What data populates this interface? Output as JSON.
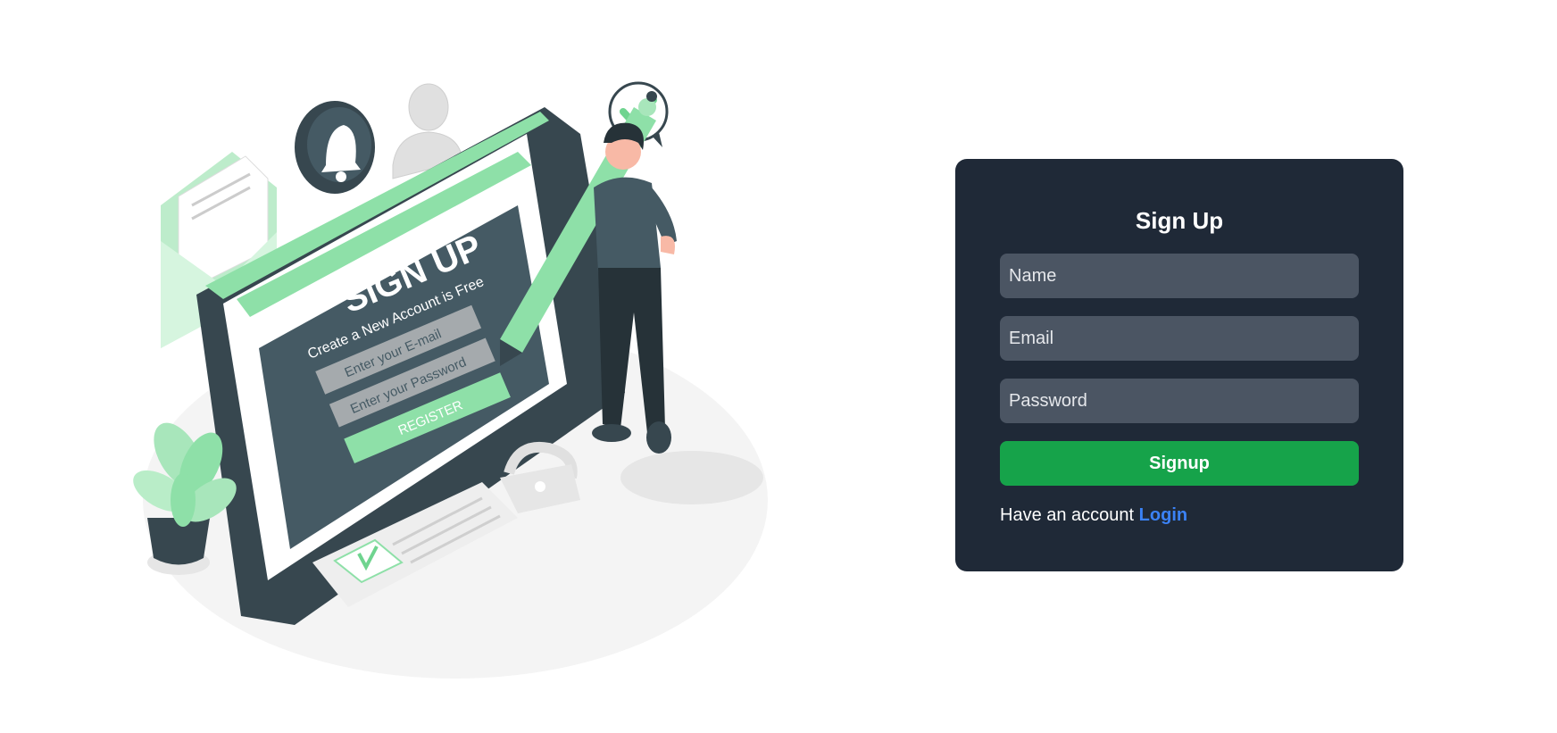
{
  "illustration": {
    "heading": "SIGN UP",
    "subheading": "Create a New Account is Free",
    "email_placeholder": "Enter your E-mail",
    "password_placeholder": "Enter your Password",
    "button_label": "REGISTER"
  },
  "form": {
    "title": "Sign Up",
    "name_placeholder": "Name",
    "email_placeholder": "Email",
    "password_placeholder": "Password",
    "submit_label": "Signup",
    "footer_text": "Have an account",
    "login_label": "Login"
  },
  "colors": {
    "card_bg": "#1f2937",
    "input_bg": "#4b5563",
    "primary_button": "#16a34a",
    "link": "#3b82f6",
    "accent_green": "#8ee0a8"
  }
}
